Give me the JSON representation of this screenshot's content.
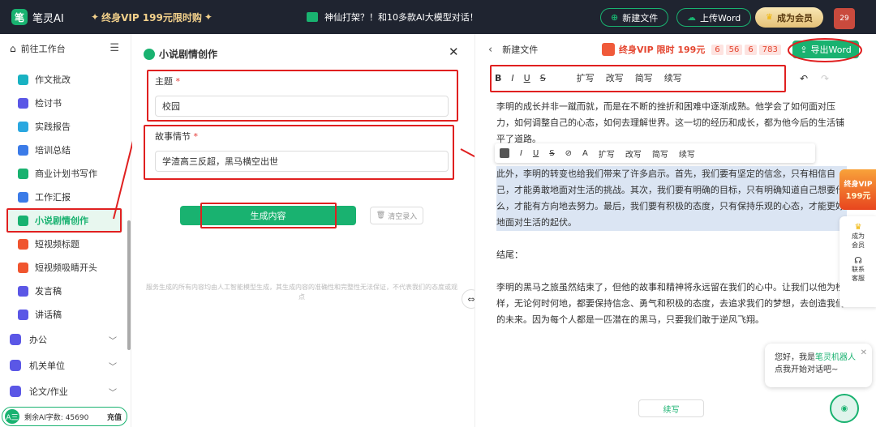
{
  "topbar": {
    "app_name": "笔灵AI",
    "logo_char": "笔",
    "promo": "终身VIP 199元限时购",
    "announcement": "神仙打架？！和10多款AI大模型对话！",
    "new_file": "新建文件",
    "upload_word": "上传Word",
    "become_member": "成为会员",
    "avatar_text": "29"
  },
  "sidebar": {
    "back_label": "前往工作台",
    "items": [
      {
        "label": "作文批改",
        "color": "#19b2c2"
      },
      {
        "label": "检讨书",
        "color": "#5b57e6"
      },
      {
        "label": "实践报告",
        "color": "#2aa7e0"
      },
      {
        "label": "培训总结",
        "color": "#3b7be8"
      },
      {
        "label": "商业计划书写作",
        "color": "#19b270"
      },
      {
        "label": "工作汇报",
        "color": "#3b7be8"
      },
      {
        "label": "小说剧情创作",
        "color": "#19b270",
        "active": true
      },
      {
        "label": "短视频标题",
        "color": "#f0552f"
      },
      {
        "label": "短视频吸睛开头",
        "color": "#f0552f"
      },
      {
        "label": "发言稿",
        "color": "#5b57e6"
      },
      {
        "label": "讲话稿",
        "color": "#5b57e6"
      }
    ],
    "categories": [
      "办公",
      "机关单位",
      "论文/作业"
    ],
    "quota_label": "剩余AI字数: 45690",
    "quota_icon": "A三",
    "recharge": "充值"
  },
  "form": {
    "title": "小说剧情创作",
    "topic_label": "主题",
    "topic_value": "校园",
    "plot_label": "故事情节",
    "plot_value": "学渣高三反超，黑马横空出世",
    "required_mark": "*",
    "generate": "生成内容",
    "clear": "清空录入",
    "disclaimer": "服务生成的所有内容均由人工智能模型生成，其生成内容的准确性和完整性无法保证，不代表我们的态度或观点"
  },
  "editor": {
    "file_title": "新建文件",
    "vip_banner": "终身VIP 限时 199元",
    "countdown": [
      "6",
      "56",
      "6",
      "783"
    ],
    "export": "导出Word",
    "toolbar": {
      "bold": "B",
      "italic": "I",
      "underline": "U",
      "strike": "S",
      "expand": "扩写",
      "rewrite": "改写",
      "simplify": "简写",
      "continue": "续写"
    },
    "float_toolbar": {
      "italic": "I",
      "underline": "U",
      "strike": "S",
      "link": "⊘",
      "font": "A",
      "expand": "扩写",
      "rewrite": "改写",
      "simplify": "简写",
      "continue": "续写"
    },
    "para1": "李明的成长并非一蹴而就，而是在不断的挫折和困难中逐渐成熟。他学会了如何面对压力，如何调整自己的心态，如何去理解世界。这一切的经历和成长，都为他今后的生活铺平了道路。",
    "para2": "此外，李明的转变也给我们带来了许多启示。首先，我们要有坚定的信念，只有相信自己，才能勇敢地面对生活的挑战。其次，我们要有明确的目标，只有明确知道自己想要什么，才能有方向地去努力。最后，我们要有积极的态度，只有保持乐观的心态，才能更好地面对生活的起伏。",
    "para3": "结尾：",
    "para4": "李明的黑马之旅虽然结束了，但他的故事和精神将永远留在我们的心中。让我们以他为榜样，无论何时何地，都要保持信念、勇气和积极的态度，去追求我们的梦想，去创造我们的未来。因为每个人都是一匹潜在的黑马，只要我们敢于逆风飞翔。",
    "side_promo_1": "终身VIP",
    "side_promo_2": "199元",
    "side_member": "成为会员",
    "side_contact": "联系客服",
    "chat_prefix": "您好，我是",
    "chat_bot_name": "笔灵机器人",
    "chat_suffix": "点我开始对话吧~",
    "continue_button": "续写"
  }
}
